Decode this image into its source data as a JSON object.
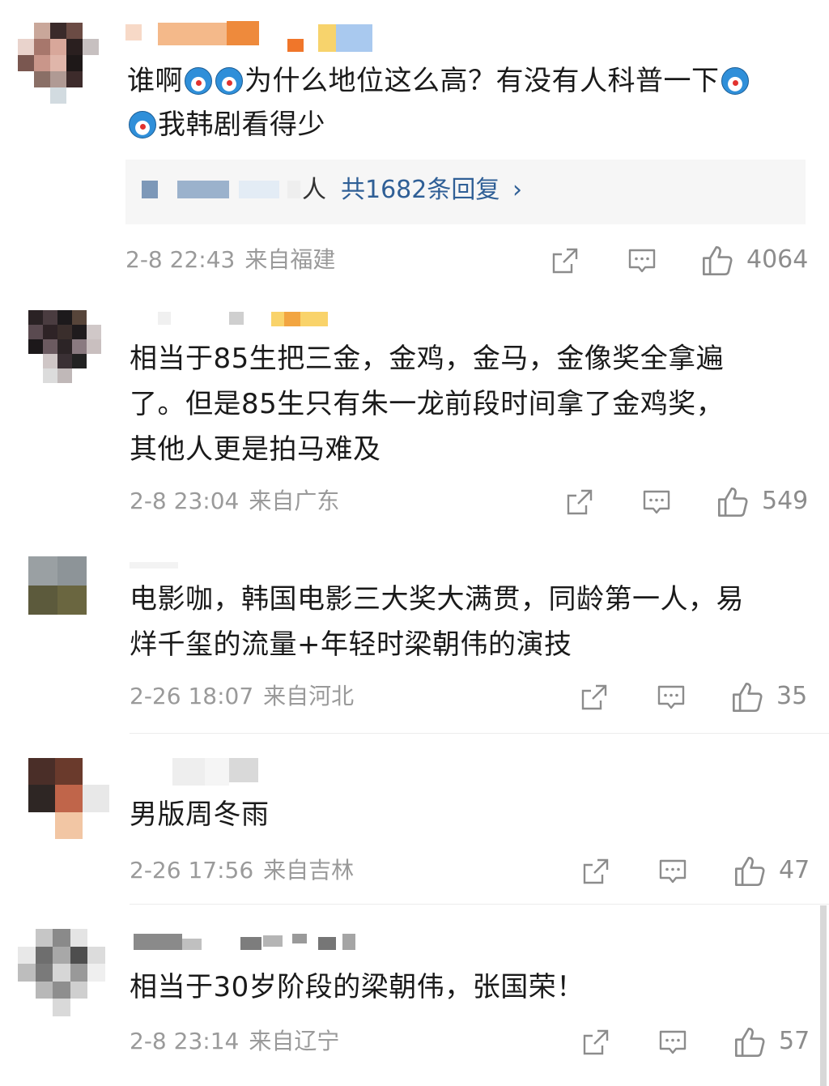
{
  "icons": {
    "share": "share-icon",
    "comment": "comment-icon",
    "like": "thumbs-up-icon"
  },
  "colors": {
    "link": "#2f5f96",
    "meta": "#9a9a9a",
    "reply_bg": "#f6f6f6"
  },
  "comments": [
    {
      "text_line1_a": "谁啊",
      "text_line1_b": "为什么地位这么高？有没有人科普一下",
      "text_line2": "我韩剧看得少",
      "replies": {
        "person_suffix": "人",
        "count_text": "共1682条回复",
        "chevron": "›"
      },
      "time": "2-8 22:43",
      "location": "来自福建",
      "likes": "4064"
    },
    {
      "text_lines": [
        "相当于85生把三金，金鸡，金马，金像奖全拿遍",
        "了。但是85生只有朱一龙前段时间拿了金鸡奖，",
        "其他人更是拍马难及"
      ],
      "time": "2-8 23:04",
      "location": "来自广东",
      "likes": "549"
    },
    {
      "text_lines": [
        "电影咖，韩国电影三大奖大满贯，同龄第一人，易",
        "烊千玺的流量+年轻时梁朝伟的演技"
      ],
      "time": "2-26 18:07",
      "location": "来自河北",
      "likes": "35"
    },
    {
      "text_lines": [
        "男版周冬雨"
      ],
      "time": "2-26 17:56",
      "location": "来自吉林",
      "likes": "47"
    },
    {
      "text_lines": [
        "相当于30岁阶段的梁朝伟，张国荣！"
      ],
      "time": "2-8 23:14",
      "location": "来自辽宁",
      "likes": "57"
    }
  ]
}
